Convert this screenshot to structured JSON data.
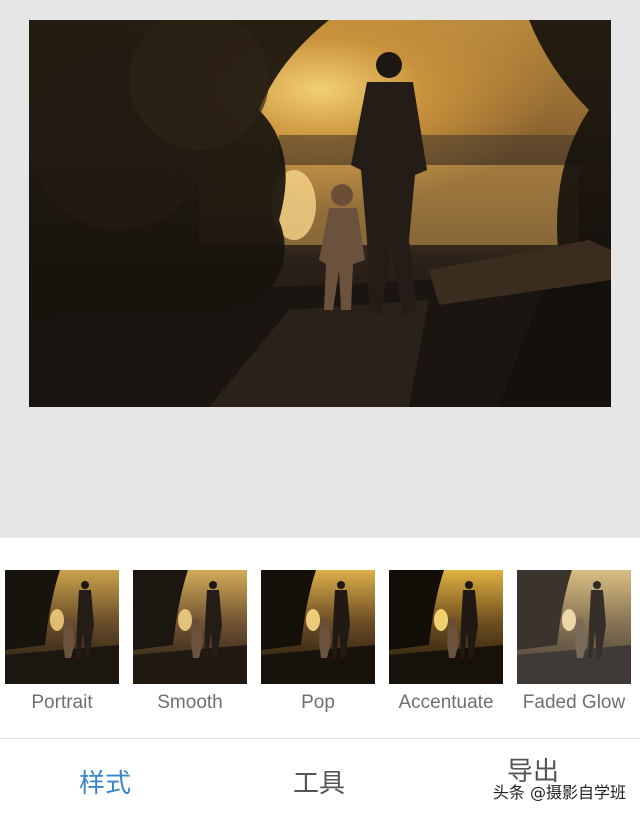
{
  "filters": [
    {
      "label": "Portrait"
    },
    {
      "label": "Smooth"
    },
    {
      "label": "Pop"
    },
    {
      "label": "Accentuate"
    },
    {
      "label": "Faded Glow"
    }
  ],
  "tabs": {
    "style": "样式",
    "tools": "工具",
    "export": "导出"
  },
  "watermark": "头条 @摄影自学班",
  "colors": {
    "accent": "#3a86c8",
    "background": "#e6e6e6"
  }
}
